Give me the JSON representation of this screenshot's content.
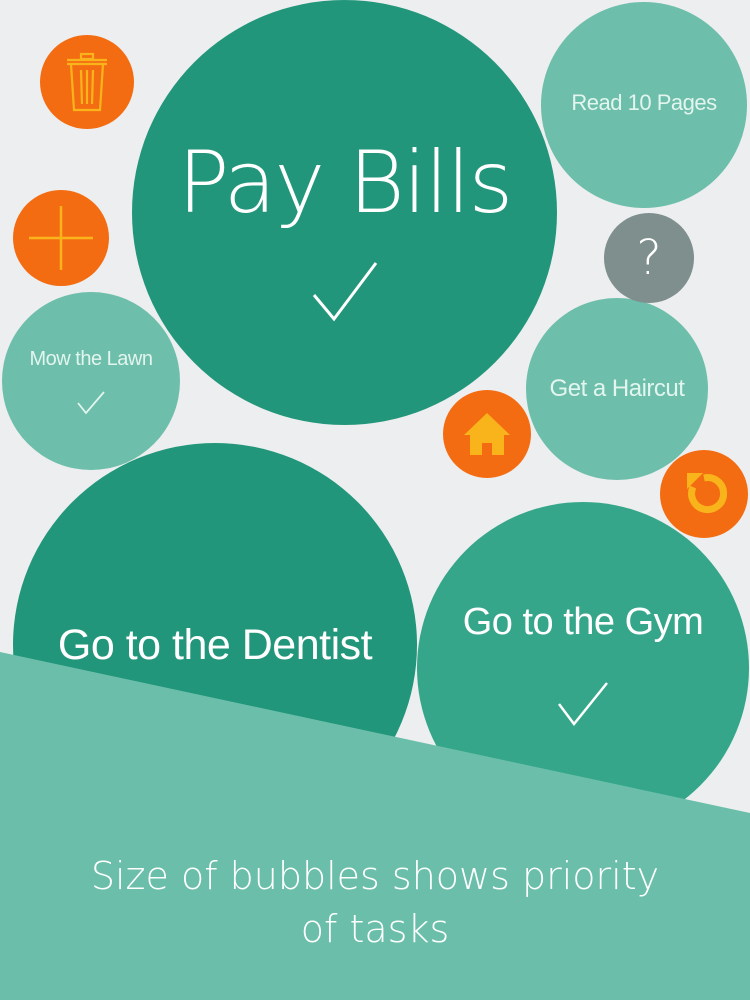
{
  "colors": {
    "background": "#eceeef",
    "bubble_dark": "#22967a",
    "bubble_light": "#6dbeaa",
    "action_orange": "#f46c12",
    "help_grey": "#7f8f8d",
    "banner": "#6bbfaa"
  },
  "tasks": [
    {
      "label": "Pay Bills",
      "done": true
    },
    {
      "label": "Read 10 Pages",
      "done": false
    },
    {
      "label": "Mow the Lawn",
      "done": true
    },
    {
      "label": "Get a Haircut",
      "done": false
    },
    {
      "label": "Go to the Dentist",
      "done": false
    },
    {
      "label": "Go to the Gym",
      "done": true
    }
  ],
  "actions": {
    "trash": "trash-icon",
    "add": "plus-icon",
    "help": "?",
    "home": "home-icon",
    "refresh": "refresh-icon"
  },
  "banner": {
    "caption_line1": "Size of bubbles shows priority",
    "caption_line2": "of  tasks"
  }
}
